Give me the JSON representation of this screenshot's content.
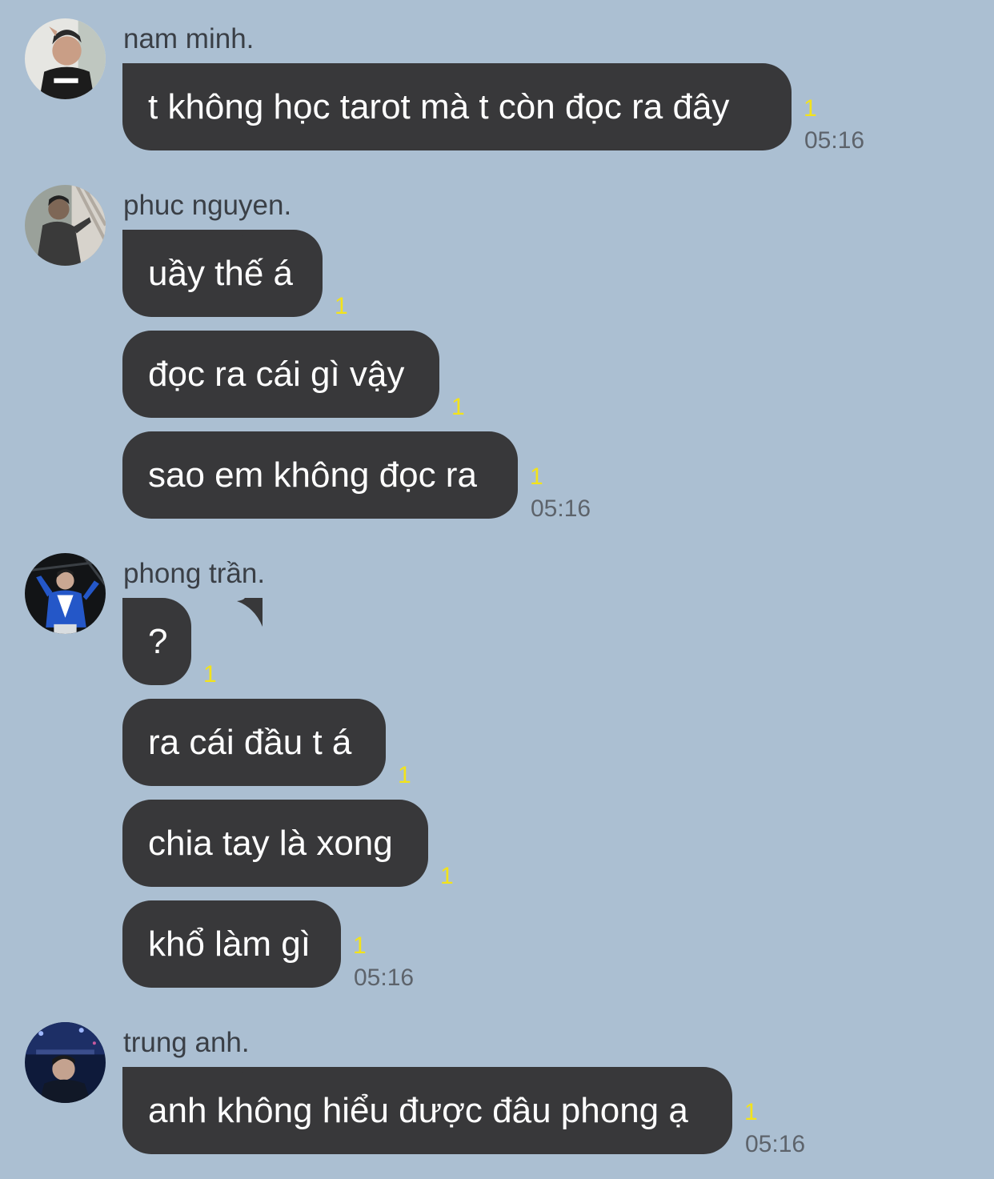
{
  "groups": [
    {
      "sender": "nam minh.",
      "messages": [
        {
          "text": "t không học tarot mà t còn đọc ra đây",
          "read_count": "1"
        }
      ],
      "time": "05:16"
    },
    {
      "sender": "phuc nguyen.",
      "messages": [
        {
          "text": "uầy thế á",
          "read_count": "1"
        },
        {
          "text": "đọc ra cái gì vậy",
          "read_count": "1"
        },
        {
          "text": "sao em không đọc ra",
          "read_count": "1"
        }
      ],
      "time": "05:16"
    },
    {
      "sender": "phong trần.",
      "messages": [
        {
          "text": "?",
          "read_count": "1"
        },
        {
          "text": "ra cái đầu t á",
          "read_count": "1"
        },
        {
          "text": "chia tay là xong",
          "read_count": "1"
        },
        {
          "text": "khổ làm gì",
          "read_count": "1"
        }
      ],
      "time": "05:16"
    },
    {
      "sender": "trung anh.",
      "messages": [
        {
          "text": "anh không hiểu được đâu phong ạ",
          "read_count": "1"
        }
      ],
      "time": "05:16"
    }
  ],
  "colors": {
    "background": "#abbfd2",
    "bubble": "#38383a",
    "bubble_text": "#ffffff",
    "read_count": "#f3e31a",
    "timestamp": "#5d636b"
  }
}
